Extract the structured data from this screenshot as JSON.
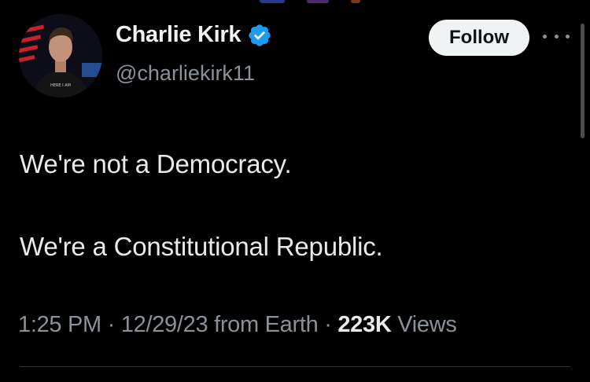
{
  "author": {
    "name": "Charlie Kirk",
    "handle": "@charliekirk11",
    "verified": true,
    "avatar_shirt_text": "HERE I AM"
  },
  "actions": {
    "follow_label": "Follow",
    "more_icon": "more-horizontal-icon"
  },
  "tweet": {
    "lines": [
      "We're not a Democracy.",
      "We're a Constitutional Republic."
    ]
  },
  "meta": {
    "time": "1:25 PM",
    "separator": "·",
    "date": "12/29/23",
    "source": "from Earth",
    "views_count": "223K",
    "views_label": "Views"
  },
  "colors": {
    "background": "#000000",
    "text": "#e7e9ea",
    "muted": "#8b9199",
    "verified": "#1d9bf0",
    "follow_bg": "#eff3f4"
  }
}
